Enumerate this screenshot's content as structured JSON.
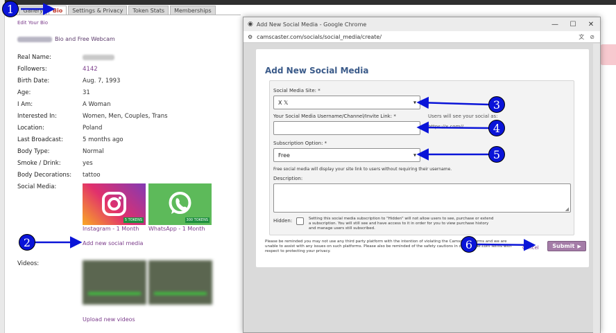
{
  "tabs": [
    "ls",
    "Gallery",
    "Bio",
    "Settings & Privacy",
    "Token Stats",
    "Memberships"
  ],
  "active_tab": "Bio",
  "edit_bio": "Edit Your Bio",
  "heading_suffix": "Bio and Free Webcam",
  "profile": [
    {
      "label": "Real Name:",
      "value": "",
      "blurred": true
    },
    {
      "label": "Followers:",
      "value": "4142",
      "link": true
    },
    {
      "label": "Birth Date:",
      "value": "Aug. 7, 1993"
    },
    {
      "label": "Age:",
      "value": "31"
    },
    {
      "label": "I Am:",
      "value": "A Woman"
    },
    {
      "label": "Interested In:",
      "value": "Women, Men, Couples, Trans"
    },
    {
      "label": "Location:",
      "value": "Poland"
    },
    {
      "label": "Last Broadcast:",
      "value": "5 months ago"
    },
    {
      "label": "Body Type:",
      "value": "Normal"
    },
    {
      "label": "Smoke / Drink:",
      "value": "yes"
    },
    {
      "label": "Body Decorations:",
      "value": "tattoo"
    },
    {
      "label": "Social Media:",
      "value": ""
    }
  ],
  "social_cards": [
    {
      "caption": "Instagram - 1 Month",
      "tokens": "5 TOKENS",
      "icon": "instagram-icon"
    },
    {
      "caption": "WhatsApp - 1 Month",
      "tokens": "300 TOKENS",
      "icon": "whatsapp-icon"
    }
  ],
  "add_social": "Add new social media",
  "videos_label": "Videos:",
  "upload_videos": "Upload new videos",
  "popup": {
    "window_title": "Add New Social Media - Google Chrome",
    "url": "camscaster.com/socials/social_media/create/",
    "heading": "Add New Social Media",
    "site_label": "Social Media Site: *",
    "site_value": "X  𝕏",
    "username_label": "Your Social Media Username/Channel/Invite Link: *",
    "username_value": "",
    "users_see_label": "Users will see your social as:",
    "users_see_value": "https://x.com//",
    "subscription_label": "Subscription Option: *",
    "subscription_value": "Free",
    "free_hint": "Free social media will display your site link to users without requiring their username.",
    "description_label": "Description:",
    "hidden_label": "Hidden:",
    "hidden_hint": "Setting this social media subscription to \"Hidden\" will not allow users to see, purchase or extend a subscription. You will still see and have access to it in order for you to view purchase history and manage users still subscribed.",
    "disclaimer": "Please be reminded you may not use any third party platform with the intention of violating the Camscaster Terms and we are unable to assist with any issues on such platforms. Please also be reminded of the safety cautions in camscaster.com Terms with respect to protecting your privacy.",
    "cancel": "Cancel",
    "submit": "Submit"
  },
  "markers": [
    "1",
    "2",
    "3",
    "4",
    "5",
    "6"
  ],
  "colors": {
    "marker": "#0a14d8",
    "heading": "#3a5a89",
    "link": "#7a3a8a",
    "submit": "#a47ca7"
  }
}
